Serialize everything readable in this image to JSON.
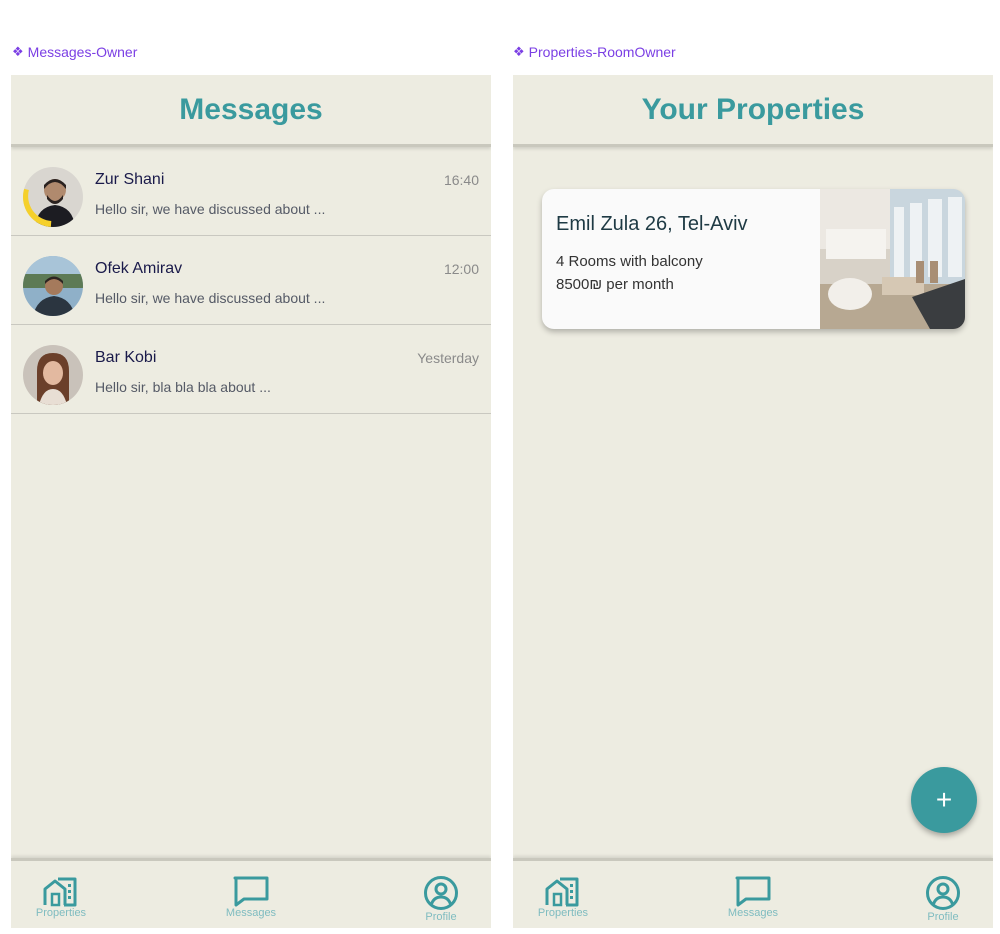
{
  "frames": {
    "left_label": "Messages-Owner",
    "right_label": "Properties-RoomOwner"
  },
  "messages_screen": {
    "title": "Messages",
    "conversations": [
      {
        "name": "Zur Shani",
        "time": "16:40",
        "preview": "Hello sir, we have discussed about ...",
        "avatar": "person-avatar-open-to-work"
      },
      {
        "name": "Ofek Amirav",
        "time": "12:00",
        "preview": "Hello sir, we have discussed about ...",
        "avatar": "person-avatar"
      },
      {
        "name": "Bar Kobi",
        "time": "Yesterday",
        "preview": "Hello sir, bla bla bla about ...",
        "avatar": "person-avatar"
      }
    ]
  },
  "properties_screen": {
    "title": "Your Properties",
    "properties": [
      {
        "address": "Emil Zula 26, Tel-Aviv",
        "rooms": "4 Rooms with balcony",
        "price": "8500₪ per month",
        "photo": "apartment-interior-photo"
      }
    ],
    "fab_label": "+"
  },
  "bottom_nav": {
    "items": [
      {
        "label": "Properties",
        "icon": "building-home-icon"
      },
      {
        "label": "Messages",
        "icon": "chat-bubble-icon"
      },
      {
        "label": "Profile",
        "icon": "user-circle-icon"
      }
    ]
  },
  "colors": {
    "accent": "#3a9a9e",
    "screen_bg": "#edece1",
    "frame_label": "#7b3fe4",
    "nav_label": "#7fbcc0"
  }
}
